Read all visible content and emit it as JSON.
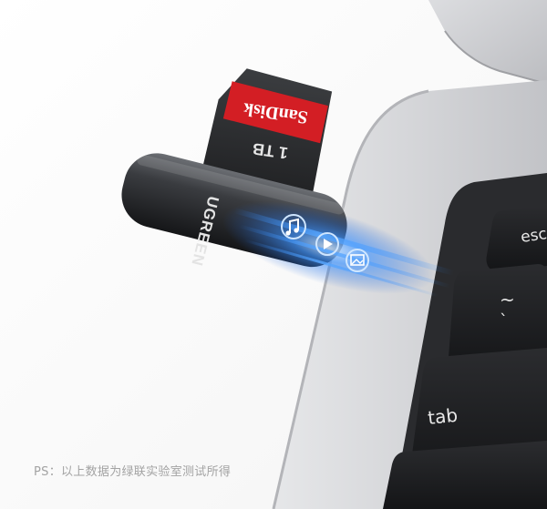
{
  "product": {
    "brand": "UGREEN",
    "card_brand": "SanDisk",
    "card_capacity": "1 TB",
    "reader_icons": [
      "music-note-icon",
      "play-icon",
      "image-icon"
    ],
    "glow_color": "#2f8bff"
  },
  "keyboard": {
    "keys": [
      "esc",
      "~",
      "tab"
    ]
  },
  "caption": "PS：以上数据为绿联实验室测试所得"
}
